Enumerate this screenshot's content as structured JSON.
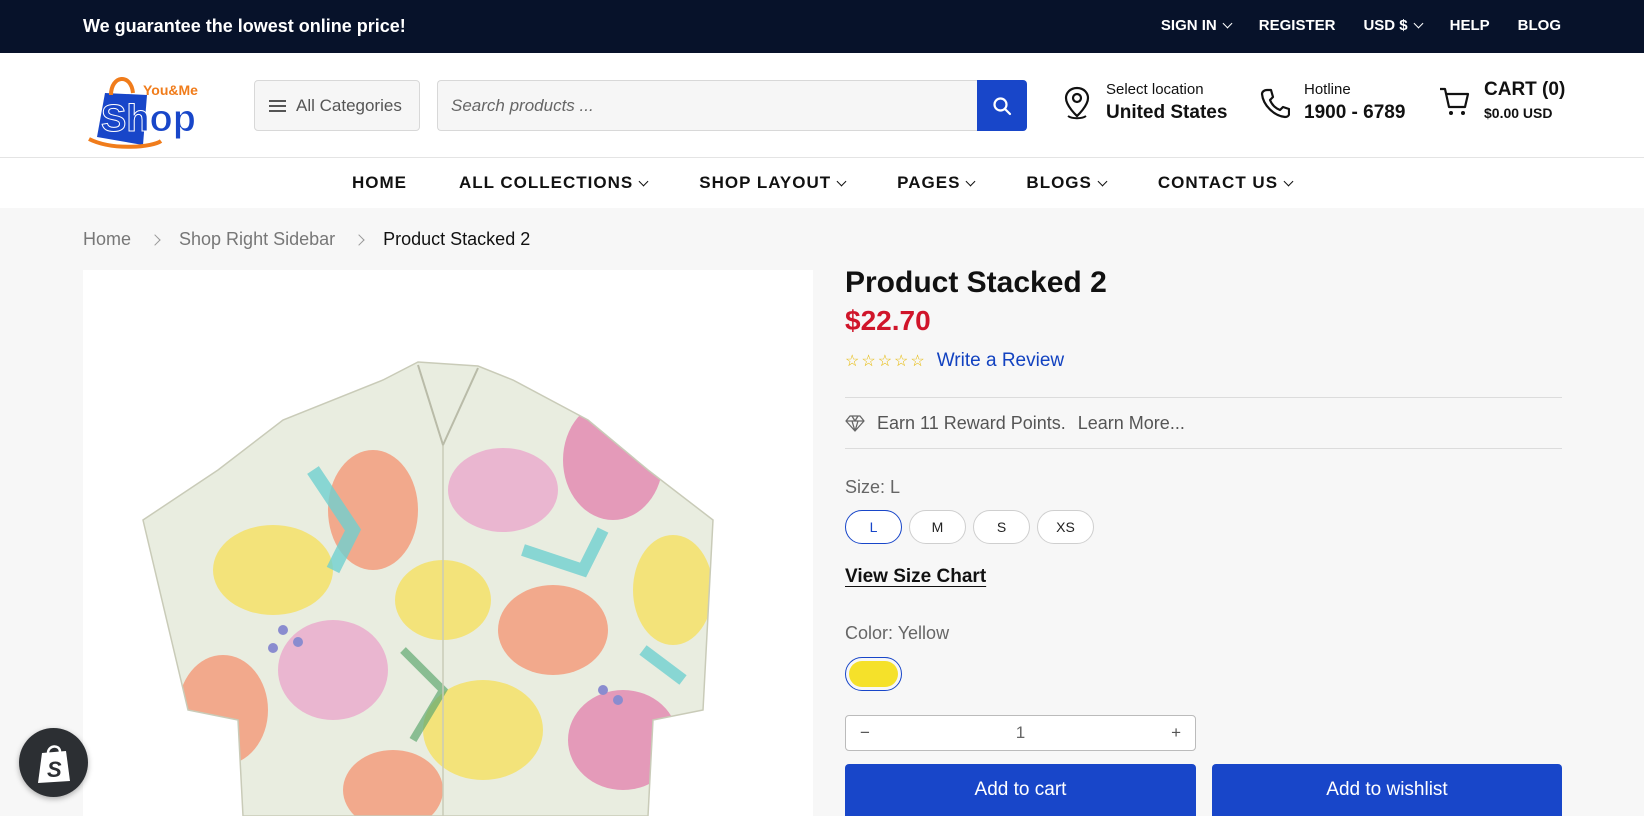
{
  "topbar": {
    "promo": "We guarantee the lowest online price!",
    "links": [
      {
        "label": "SIGN IN",
        "dropdown": true
      },
      {
        "label": "REGISTER",
        "dropdown": false
      },
      {
        "label": "USD $",
        "dropdown": true
      },
      {
        "label": "HELP",
        "dropdown": false
      },
      {
        "label": "BLOG",
        "dropdown": false
      }
    ]
  },
  "header": {
    "logo": {
      "top": "You&Me",
      "main": "Shop"
    },
    "categories_label": "All Categories",
    "search_placeholder": "Search products ...",
    "location": {
      "label": "Select location",
      "value": "United States"
    },
    "hotline": {
      "label": "Hotline",
      "value": "1900 - 6789"
    },
    "cart": {
      "label": "CART (0)",
      "total": "$0.00 USD"
    }
  },
  "nav": [
    "HOME",
    "ALL COLLECTIONS",
    "SHOP LAYOUT",
    "PAGES",
    "BLOGS",
    "CONTACT US"
  ],
  "breadcrumb": {
    "items": [
      "Home",
      "Shop Right Sidebar"
    ],
    "current": "Product Stacked 2"
  },
  "product": {
    "title": "Product Stacked 2",
    "price": "$22.70",
    "rating_stars": 0,
    "write_review": "Write a Review",
    "reward_text": "Earn 11 Reward Points.",
    "learn_more": "Learn More...",
    "size_label": "Size: L",
    "sizes": [
      "L",
      "M",
      "S",
      "XS"
    ],
    "selected_size": "L",
    "size_chart": "View Size Chart",
    "color_label": "Color: Yellow",
    "color_value": "#f5e12a",
    "quantity": "1",
    "qty_minus": "−",
    "qty_plus": "+",
    "add_to_cart": "Add to cart",
    "add_to_wishlist": "Add to wishlist"
  },
  "colors": {
    "accent": "#1846c9",
    "price": "#d0152a",
    "topbar": "#07122a",
    "logo_orange": "#f07c1b"
  }
}
